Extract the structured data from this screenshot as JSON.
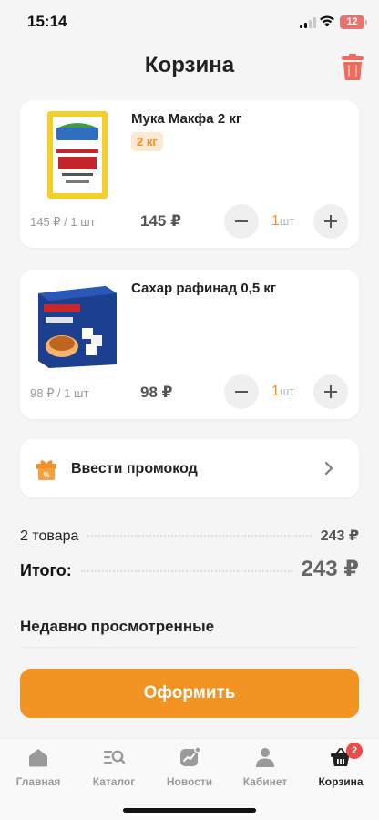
{
  "status_bar": {
    "time": "15:14",
    "battery": "12"
  },
  "header": {
    "title": "Корзина",
    "trash_icon": "trash-icon"
  },
  "colors": {
    "accent": "#f29423",
    "accent_light": "#fde8d2",
    "badge_red": "#ef4a44",
    "trash_red": "#f26a5d"
  },
  "cart_items": [
    {
      "name": "Мука Макфа 2 кг",
      "weight_badge": "2 кг",
      "unit_price": "145 ₽ / 1 шт",
      "total_price": "145 ₽",
      "quantity": "1",
      "quantity_unit": "шт",
      "image": "makfa-flour-package"
    },
    {
      "name": "Сахар рафинад 0,5 кг",
      "unit_price": "98 ₽ / 1 шт",
      "total_price": "98 ₽",
      "quantity": "1",
      "quantity_unit": "шт",
      "image": "chainofsky-sugar-box"
    }
  ],
  "promo": {
    "label": "Ввести промокод",
    "icon": "gift-icon"
  },
  "summary": {
    "items_label": "2 товара",
    "items_price": "243 ₽",
    "total_label": "Итого:",
    "total_value": "243 ₽"
  },
  "recently_viewed": {
    "title": "Недавно просмотренные"
  },
  "checkout": {
    "label": "Оформить"
  },
  "tab_bar": {
    "tabs": [
      {
        "label": "Главная",
        "icon": "home-icon"
      },
      {
        "label": "Каталог",
        "icon": "catalog-search-icon"
      },
      {
        "label": "Новости",
        "icon": "news-chart-icon"
      },
      {
        "label": "Кабинет",
        "icon": "profile-icon"
      },
      {
        "label": "Корзина",
        "icon": "basket-icon",
        "badge": "2",
        "active": true
      }
    ]
  }
}
